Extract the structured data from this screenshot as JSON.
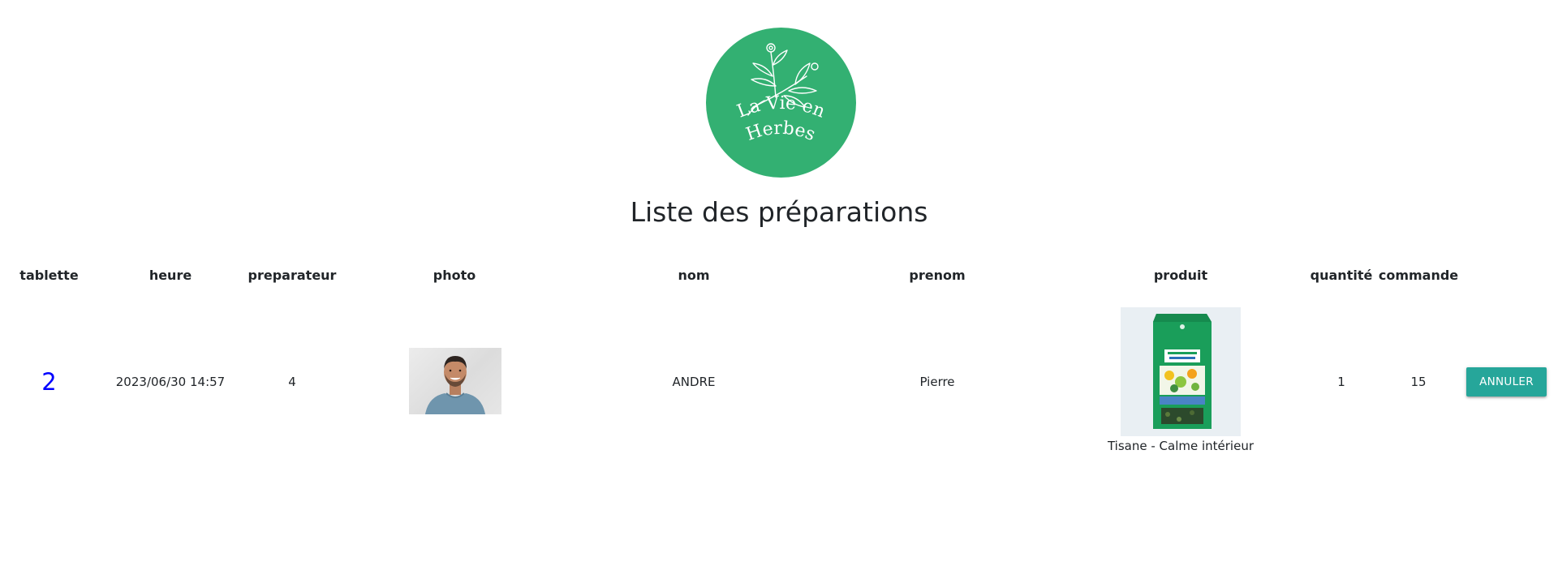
{
  "brand": {
    "logo_line1": "La Vie en",
    "logo_line2": "Herbes",
    "logo_color": "#33b072"
  },
  "page": {
    "title": "Liste des préparations"
  },
  "table": {
    "headers": {
      "tablette": "tablette",
      "heure": "heure",
      "preparateur": "preparateur",
      "photo": "photo",
      "nom": "nom",
      "prenom": "prenom",
      "produit": "produit",
      "quantite": "quantité",
      "commande": "commande"
    },
    "rows": [
      {
        "tablette": "2",
        "heure": "2023/06/30 14:57",
        "preparateur": "4",
        "photo_icon": "person-photo",
        "nom": "ANDRE",
        "prenom": "Pierre",
        "produit_image_icon": "tea-package-photo",
        "produit": "Tisane - Calme intérieur",
        "quantite": "1",
        "commande": "15",
        "action_label": "ANNULER"
      }
    ]
  },
  "colors": {
    "link": "#0000ff",
    "button": "#26a69a"
  }
}
